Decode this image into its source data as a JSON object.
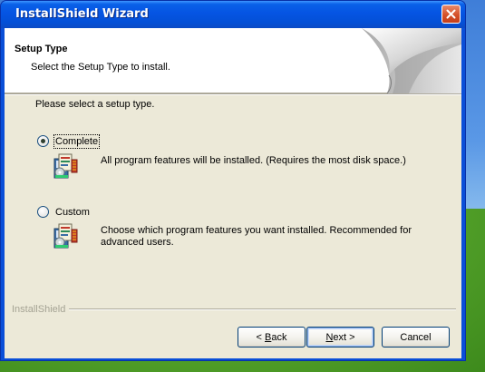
{
  "window": {
    "title": "InstallShield Wizard"
  },
  "header": {
    "title": "Setup Type",
    "subtitle": "Select the Setup Type to install."
  },
  "prompt": "Please select a setup type.",
  "options": [
    {
      "label": "Complete",
      "selected": true,
      "icon": "installer-package-icon",
      "description": "All program features will be installed. (Requires the most disk space.)"
    },
    {
      "label": "Custom",
      "selected": false,
      "icon": "installer-package-icon",
      "description": "Choose which program features you want installed. Recommended for advanced users."
    }
  ],
  "branding": "InstallShield",
  "buttons": {
    "back": {
      "prefix": "< ",
      "hotkey": "B",
      "rest": "ack"
    },
    "next": {
      "hotkey": "N",
      "rest": "ext >"
    },
    "cancel": "Cancel"
  },
  "colors": {
    "titlebar": "#0554e3",
    "dialog_face": "#ece9d8",
    "close_button": "#d5512a",
    "branding_text": "#a5a394"
  }
}
